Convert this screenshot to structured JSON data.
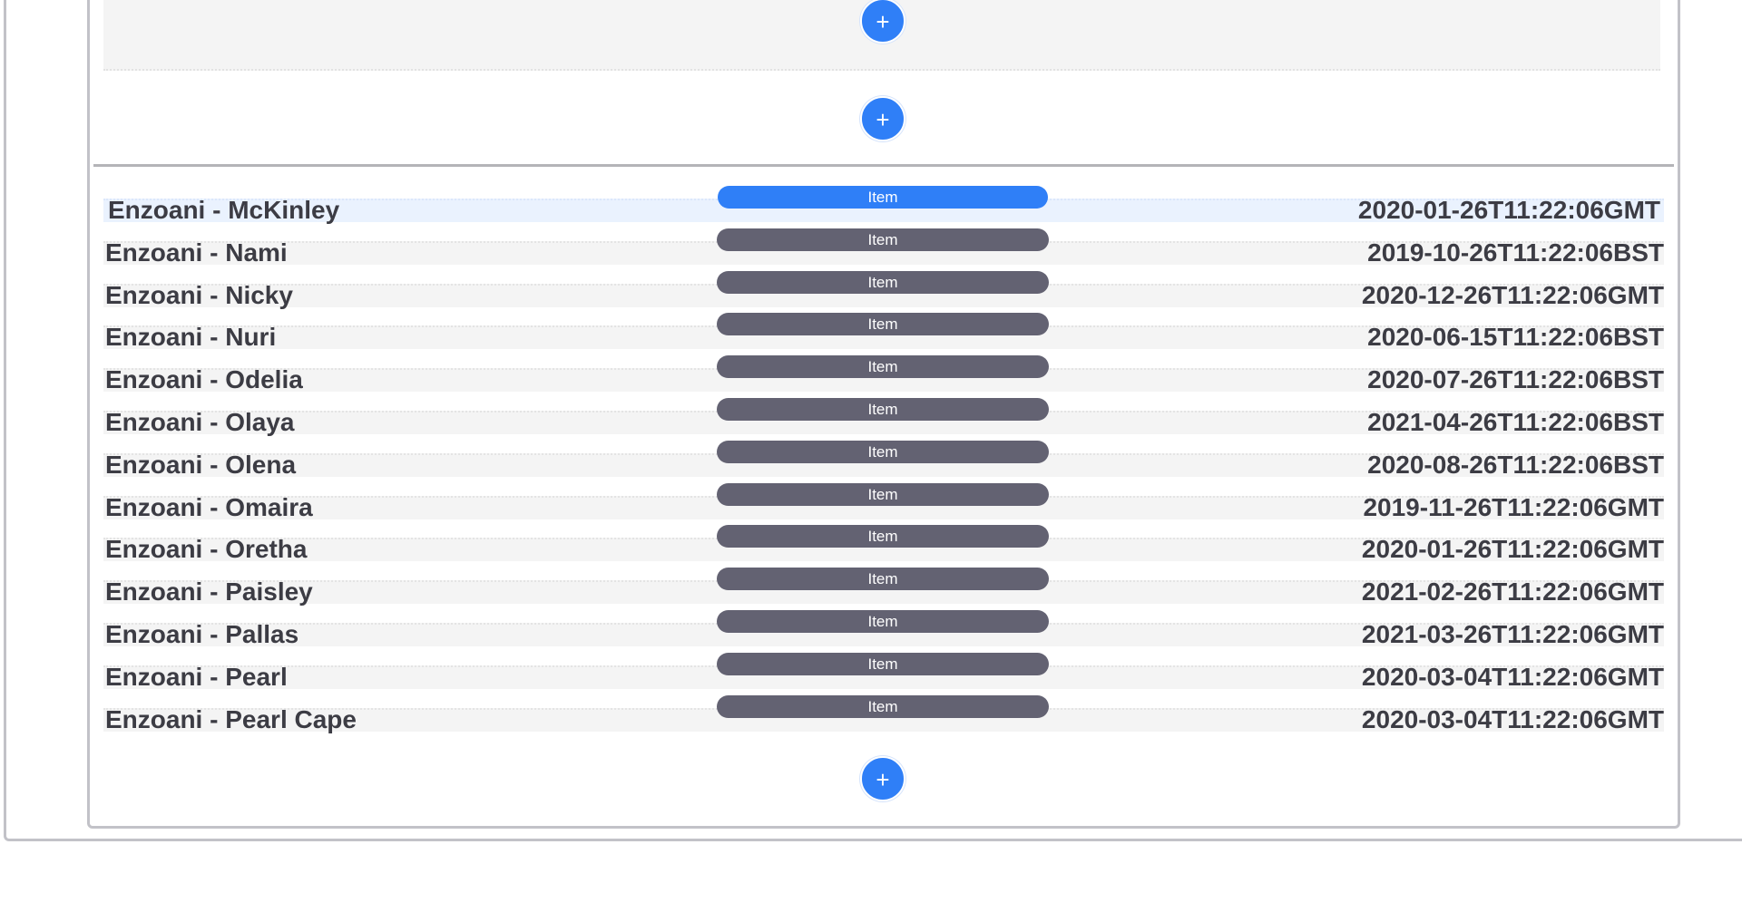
{
  "add_icon_glyph": "+",
  "accent_color": "#2f7ff7",
  "pill_color": "#636272",
  "rows": [
    {
      "name": "Enzoani - McKinley",
      "tag": "Item",
      "date": "2020-01-26T11:22:06GMT",
      "selected": true
    },
    {
      "name": "Enzoani - Nami",
      "tag": "Item",
      "date": "2019-10-26T11:22:06BST",
      "selected": false
    },
    {
      "name": "Enzoani - Nicky",
      "tag": "Item",
      "date": "2020-12-26T11:22:06GMT",
      "selected": false
    },
    {
      "name": "Enzoani - Nuri",
      "tag": "Item",
      "date": "2020-06-15T11:22:06BST",
      "selected": false
    },
    {
      "name": "Enzoani - Odelia",
      "tag": "Item",
      "date": "2020-07-26T11:22:06BST",
      "selected": false
    },
    {
      "name": "Enzoani - Olaya",
      "tag": "Item",
      "date": "2021-04-26T11:22:06BST",
      "selected": false
    },
    {
      "name": "Enzoani - Olena",
      "tag": "Item",
      "date": "2020-08-26T11:22:06BST",
      "selected": false
    },
    {
      "name": "Enzoani - Omaira",
      "tag": "Item",
      "date": "2019-11-26T11:22:06GMT",
      "selected": false
    },
    {
      "name": "Enzoani - Oretha",
      "tag": "Item",
      "date": "2020-01-26T11:22:06GMT",
      "selected": false
    },
    {
      "name": "Enzoani - Paisley",
      "tag": "Item",
      "date": "2021-02-26T11:22:06GMT",
      "selected": false
    },
    {
      "name": "Enzoani - Pallas",
      "tag": "Item",
      "date": "2021-03-26T11:22:06GMT",
      "selected": false
    },
    {
      "name": "Enzoani - Pearl",
      "tag": "Item",
      "date": "2020-03-04T11:22:06GMT",
      "selected": false
    },
    {
      "name": "Enzoani - Pearl Cape",
      "tag": "Item",
      "date": "2020-03-04T11:22:06GMT",
      "selected": false
    }
  ]
}
